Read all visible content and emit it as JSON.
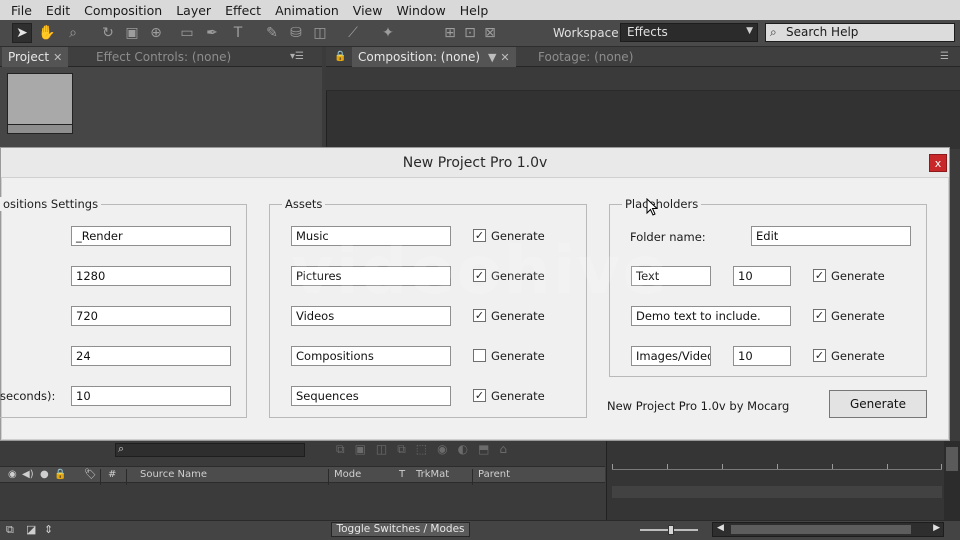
{
  "menubar": [
    "File",
    "Edit",
    "Composition",
    "Layer",
    "Effect",
    "Animation",
    "View",
    "Window",
    "Help"
  ],
  "toolbar": {
    "workspace_label": "Workspace:",
    "workspace_value": "Effects",
    "search_help": "Search Help"
  },
  "tabs": {
    "project": "Project",
    "effect_controls": "Effect Controls: (none)",
    "composition": "Composition: (none)",
    "footage": "Footage: (none)"
  },
  "dialog": {
    "title": "New Project Pro 1.0v",
    "close": "x",
    "comp_settings": {
      "label": "ositions Settings",
      "fields": [
        "_Render",
        "1280",
        "720",
        "24",
        "10"
      ],
      "duration_label": "seconds):"
    },
    "assets": {
      "label": "Assets",
      "rows": [
        {
          "name": "Music",
          "checked": true,
          "check_label": "Generate"
        },
        {
          "name": "Pictures",
          "checked": true,
          "check_label": "Generate"
        },
        {
          "name": "Videos",
          "checked": true,
          "check_label": "Generate"
        },
        {
          "name": "Compositions",
          "checked": false,
          "check_label": "Generate"
        },
        {
          "name": "Sequences",
          "checked": true,
          "check_label": "Generate"
        }
      ]
    },
    "placeholders": {
      "label": "Placeholders",
      "folder_name_label": "Folder name:",
      "folder_name_value": "Edit",
      "rows": [
        {
          "name": "Text",
          "count": "10",
          "checked": true,
          "check_label": "Generate"
        },
        {
          "name": "Demo text to include.",
          "checked": true,
          "check_label": "Generate"
        },
        {
          "name": "Images/Videos",
          "count": "10",
          "checked": true,
          "check_label": "Generate"
        }
      ]
    },
    "credit": "New Project Pro 1.0v by Mocarg",
    "generate_button": "Generate"
  },
  "timeline": {
    "columns": [
      "#",
      "Source Name",
      "Mode",
      "T",
      "TrkMat",
      "Parent"
    ],
    "toggle_button": "Toggle Switches / Modes"
  },
  "watermark": "videohive"
}
